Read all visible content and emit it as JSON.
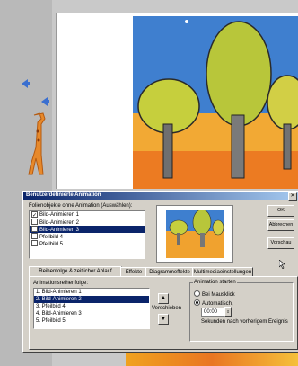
{
  "dialog": {
    "title": "Benutzerdefinierte Animation",
    "close": "✕",
    "objects_label": "Folienobjekte ohne Animation (Auswählen):",
    "objects": [
      {
        "label": "Bild-Animieren 1",
        "checked": true,
        "selected": false
      },
      {
        "label": "Bild-Animieren 2",
        "checked": true,
        "selected": false
      },
      {
        "label": "Bild-Animieren 3",
        "checked": true,
        "selected": true
      },
      {
        "label": "Pfeilbild 4",
        "checked": true,
        "selected": false
      },
      {
        "label": "Pfeilbild 5",
        "checked": true,
        "selected": false
      }
    ],
    "buttons": {
      "ok": "OK",
      "cancel": "Abbrechen",
      "preview": "Vorschau"
    },
    "tabs": [
      "Reihenfolge & zeitlicher Ablauf",
      "Effekte",
      "Diagrammeffekte",
      "Multimediaeinstellungen"
    ],
    "order_label": "Animationsreihenfolge:",
    "order": [
      {
        "label": "1. Bild-Animieren 1",
        "selected": false
      },
      {
        "label": "2. Bild-Animieren 2",
        "selected": true
      },
      {
        "label": "3. Pfeilbild 4",
        "selected": false
      },
      {
        "label": "4. Bild-Animieren 3",
        "selected": false
      },
      {
        "label": "5. Pfeilbild 5",
        "selected": false
      }
    ],
    "move_label": "Verschieben",
    "start_group_label": "Animation starten",
    "start_on_click": "Bei Mausklick",
    "start_auto": "Automatisch,",
    "seconds_value": "00:00",
    "seconds_suffix": "Sekunden nach vorherigem Ereignis"
  }
}
